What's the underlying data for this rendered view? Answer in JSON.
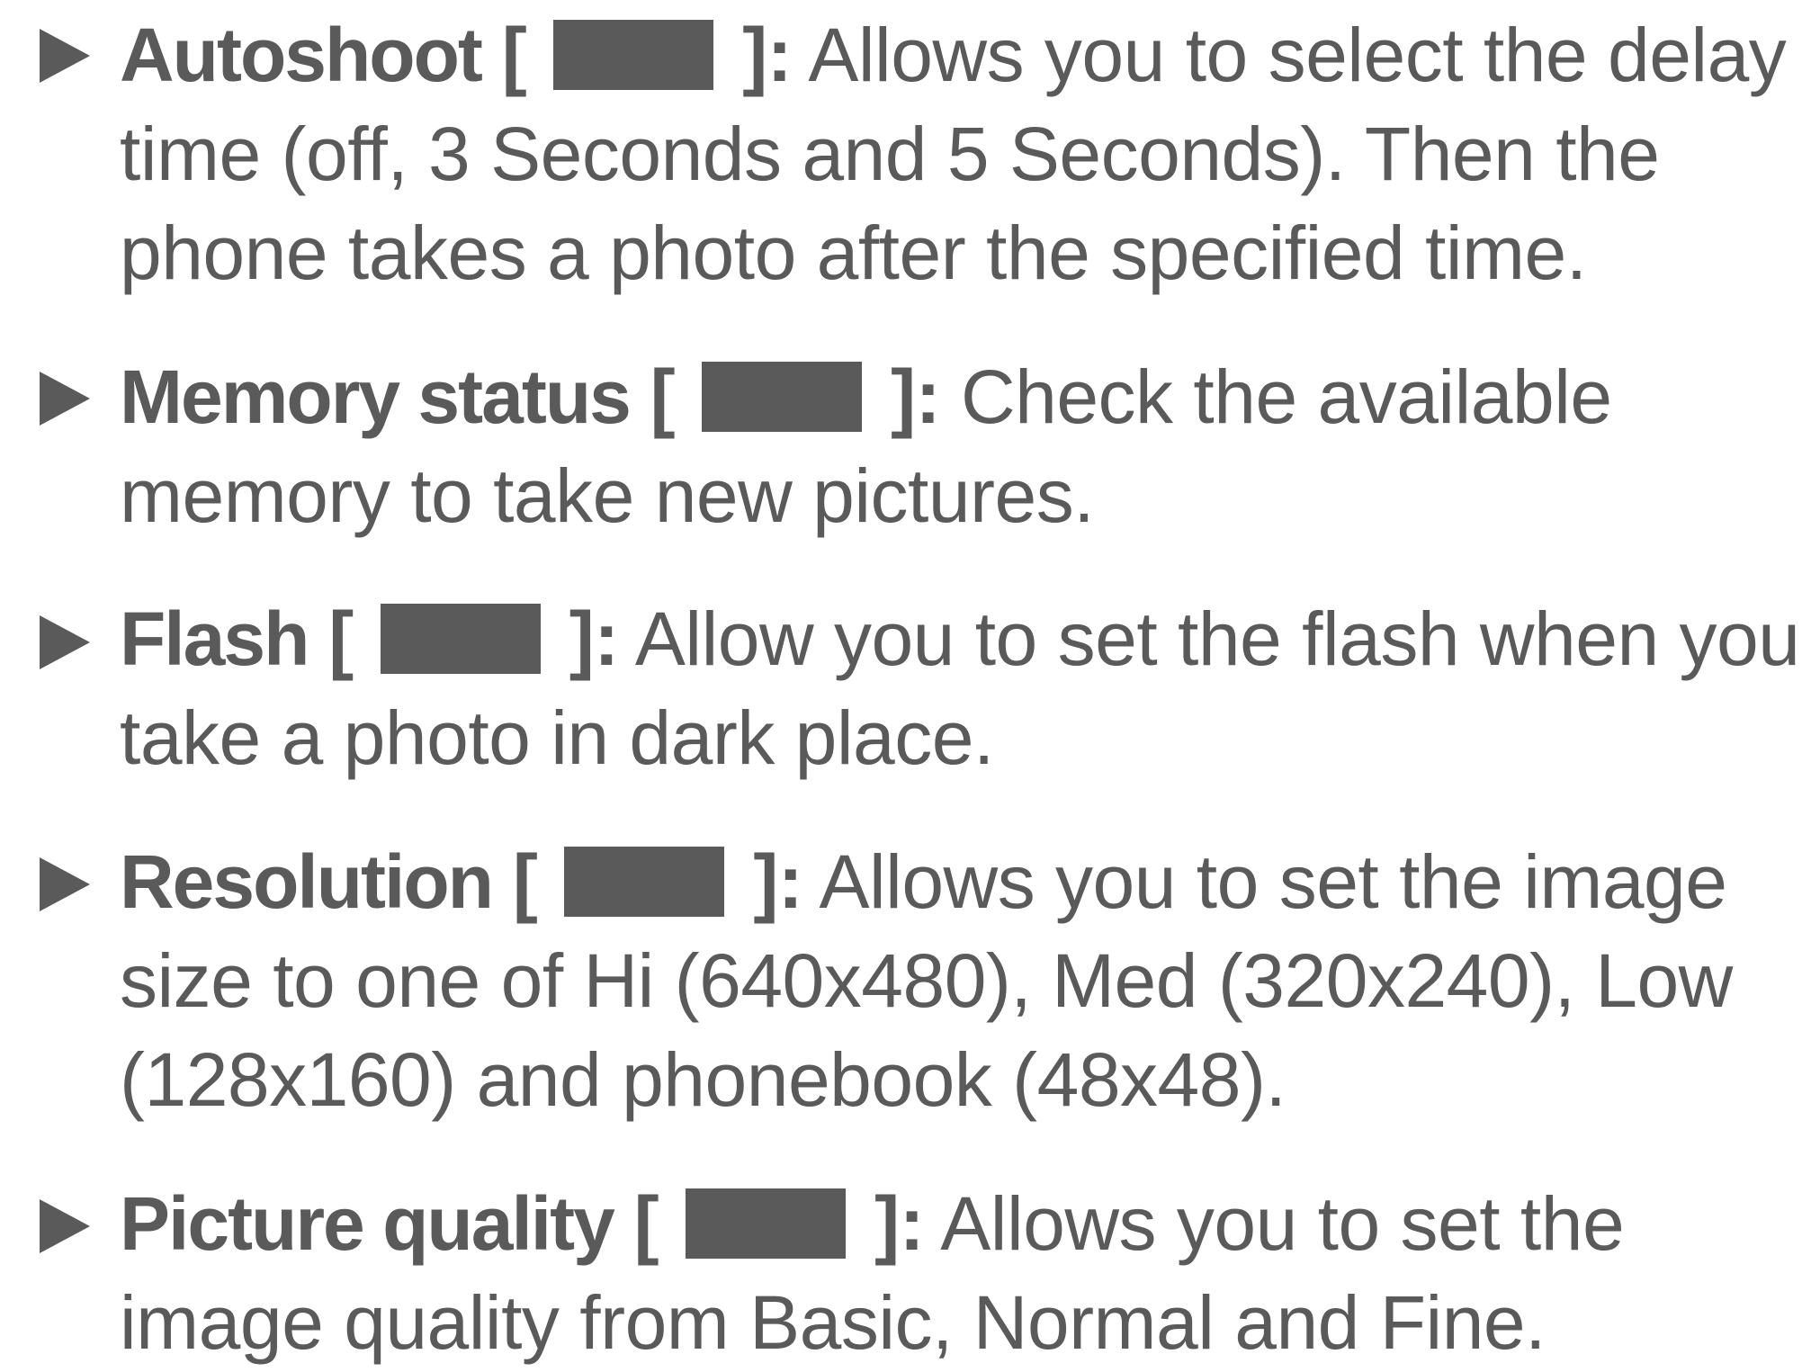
{
  "entries": [
    {
      "term": "Autoshoot",
      "icon": "autoshoot-icon",
      "lines": [
        "Allows you to select the delay",
        "time (off, 3 Seconds and 5 Seconds). Then the",
        "phone takes a photo after the specified time."
      ]
    },
    {
      "term": "Memory status",
      "icon": "memory-status-icon",
      "lines": [
        "Check the available",
        "memory to take new pictures."
      ]
    },
    {
      "term": "Flash",
      "icon": "flash-icon",
      "lines": [
        "Allow you to set the flash when you",
        "take a photo in dark place."
      ]
    },
    {
      "term": "Resolution",
      "icon": "resolution-icon",
      "lines": [
        "Allows you to set the image",
        "size to one of Hi (640x480), Med (320x240), Low",
        "(128x160) and phonebook (48x48)."
      ]
    },
    {
      "term": "Picture quality",
      "icon": "picture-quality-icon",
      "lines": [
        "Allows you to set the",
        "image quality from Basic, Normal and Fine."
      ]
    }
  ],
  "colors": {
    "text": "#5a5a5a",
    "background": "#ffffff"
  }
}
